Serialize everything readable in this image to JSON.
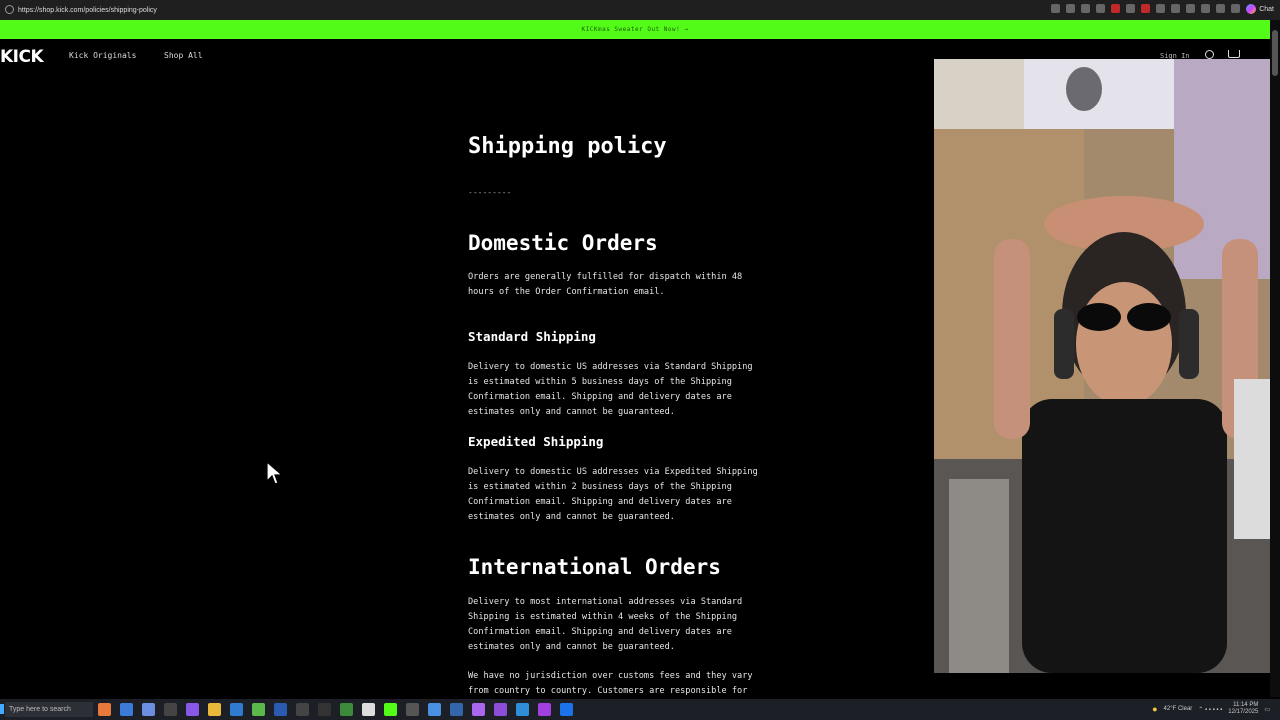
{
  "browser": {
    "url": "https://shop.kick.com/policies/shipping-policy",
    "chat_label": "Chat"
  },
  "announcement": "KICKmas Sweater Out Now! →",
  "site": {
    "logo": "KICK",
    "nav": [
      "Kick Originals",
      "Shop All"
    ],
    "sign_in": "Sign In",
    "accent_color": "#53fc18"
  },
  "page": {
    "title": "Shipping policy",
    "divider": "---------",
    "domestic": {
      "heading": "Domestic Orders",
      "intro": "Orders are generally fulfilled for dispatch within 48 hours of the Order Confirmation email.",
      "standard_heading": "Standard Shipping",
      "standard_text": "Delivery to domestic US addresses via Standard Shipping is estimated within 5 business days of the Shipping Confirmation email. Shipping and delivery dates are estimates only and cannot be guaranteed.",
      "expedited_heading": "Expedited Shipping",
      "expedited_text": "Delivery to domestic US addresses via Expedited Shipping is estimated within 2 business days of the Shipping Confirmation email. Shipping and delivery dates are estimates only and cannot be guaranteed."
    },
    "international": {
      "heading": "International Orders",
      "text": "Delivery to most international addresses via Standard Shipping is estimated within 4 weeks of the Shipping Confirmation email. Shipping and delivery dates are estimates only and cannot be guaranteed.",
      "customs_text": "We have no jurisdiction over customs fees and they vary from country to country. Customers are responsible for"
    }
  },
  "taskbar": {
    "search_placeholder": "Type here to search",
    "weather": "42°F Clear",
    "time": "11:14 PM",
    "date": "12/17/2025"
  }
}
